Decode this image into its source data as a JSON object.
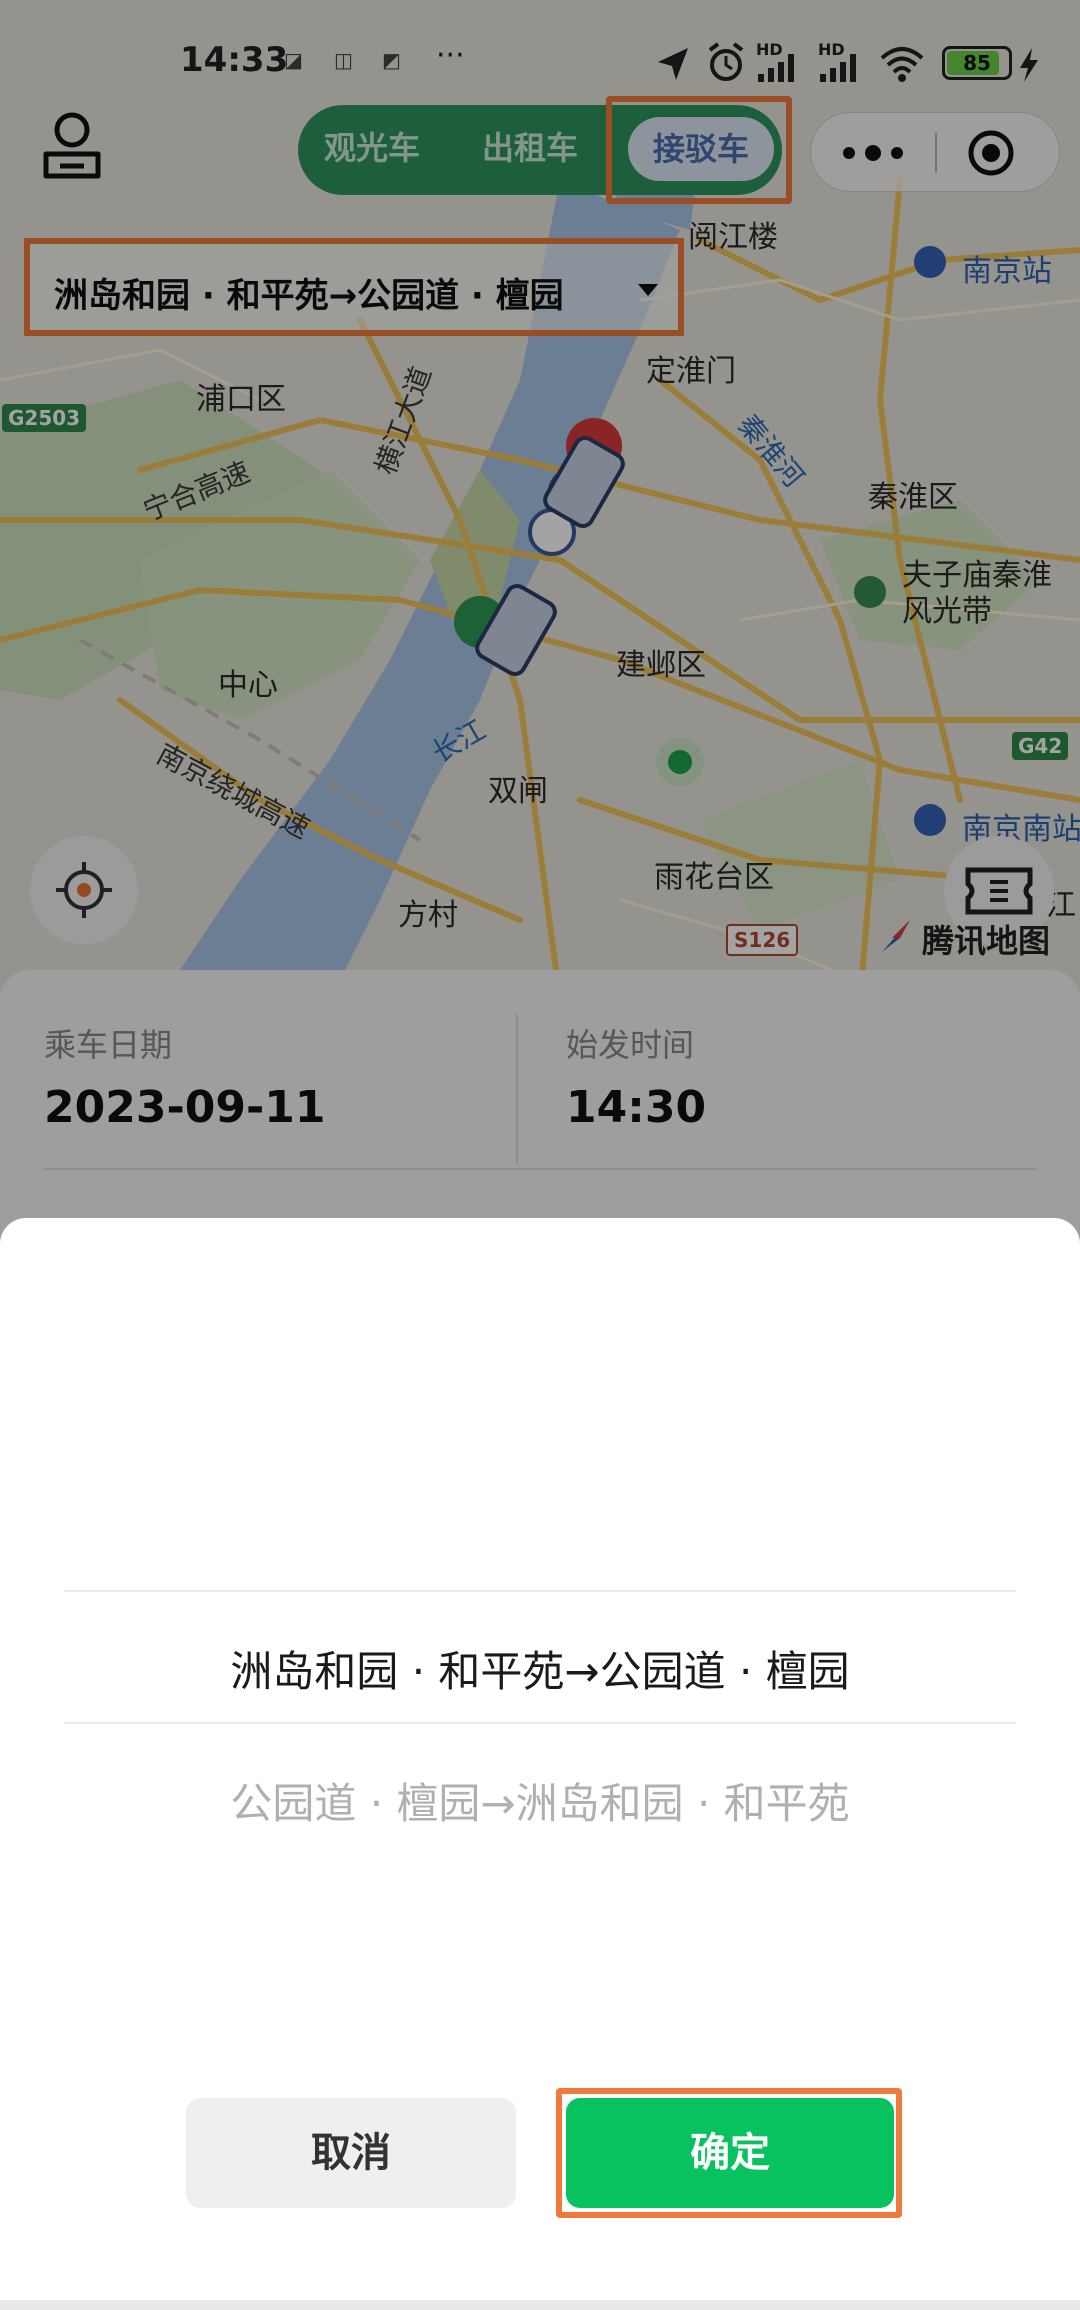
{
  "status_bar": {
    "time": "14:33",
    "dots": "···",
    "battery_level": "85",
    "signal_1": "HD",
    "signal_2": "HD"
  },
  "top_nav": {
    "tabs": [
      {
        "label": "观光车"
      },
      {
        "label": "出租车"
      },
      {
        "label": "接驳车",
        "active": true
      }
    ],
    "highlight_color": "#f07a3c",
    "accent_color": "#2e9460"
  },
  "route_selector": {
    "value": "洲岛和园 · 和平苑→公园道 · 檀园"
  },
  "map": {
    "labels": {
      "yuejianglou": "阅江楼",
      "nanjing_station": "南京站",
      "dinghuaimen": "定淮门",
      "pukou": "浦口区",
      "qinhuai": "秦淮区",
      "qinhuai_river": "秦淮河",
      "ninghe_highway": "宁合高速",
      "hengjiang": "横江大道",
      "fuzimiao": "夫子庙秦淮\n风光带",
      "zhongxin": "中心",
      "jianye": "建邺区",
      "changjiang": "长江",
      "shuangzha": "双闸",
      "ring_highway": "南京绕城高速",
      "yuhuatai": "雨花台区",
      "fangcun": "方村",
      "nanjing_south": "南京南站",
      "jiang": "江",
      "g2503": "G2503",
      "g42": "G42",
      "s126": "S126"
    },
    "brand": "腾讯地图"
  },
  "form": {
    "date_label": "乘车日期",
    "date_value": "2023-09-11",
    "time_label": "始发时间",
    "time_value": "14:30"
  },
  "picker": {
    "options": [
      {
        "label": "洲岛和园 · 和平苑→公园道 · 檀园",
        "selected": true
      },
      {
        "label": "公园道 · 檀园→洲岛和园 · 和平苑",
        "selected": false
      }
    ]
  },
  "actions": {
    "cancel_label": "取消",
    "confirm_label": "确定",
    "confirm_color": "#08c25f"
  }
}
